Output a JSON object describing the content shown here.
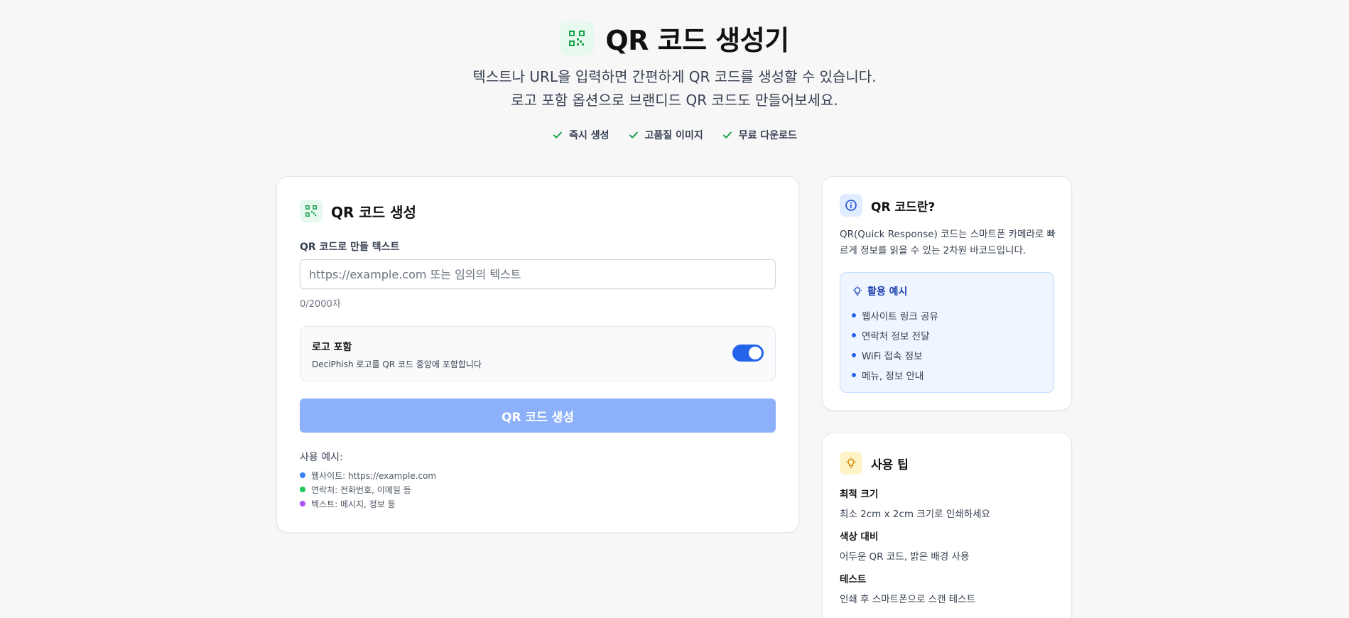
{
  "header": {
    "title": "QR 코드 생성기",
    "subtitle_line1": "텍스트나 URL을 입력하면 간편하게 QR 코드를 생성할 수 있습니다.",
    "subtitle_line2": "로고 포함 옵션으로 브랜디드 QR 코드도 만들어보세요.",
    "features": [
      "즉시 생성",
      "고품질 이미지",
      "무료 다운로드"
    ]
  },
  "generator": {
    "title": "QR 코드 생성",
    "field_label": "QR 코드로 만들 텍스트",
    "input_placeholder": "https://example.com 또는 임의의 텍스트",
    "input_value": "",
    "counter": "0/2000자",
    "logo_option": {
      "title": "로고 포함",
      "description": "DeciPhish 로고를 QR 코드 중앙에 포함합니다",
      "enabled": true
    },
    "button_label": "QR 코드 생성",
    "examples_label": "사용 예시:",
    "examples": [
      {
        "text": "웹사이트: https://example.com",
        "color": "#3b82f6"
      },
      {
        "text": "연락처: 전화번호, 이메일 등",
        "color": "#22c55e"
      },
      {
        "text": "텍스트: 메시지, 정보 등",
        "color": "#a855f7"
      }
    ]
  },
  "about": {
    "title": "QR 코드란?",
    "description": "QR(Quick Response) 코드는 스마트폰 카메라로 빠르게 정보를 읽을 수 있는 2차원 바코드입니다.",
    "usage_title": "활용 예시",
    "usage_items": [
      "웹사이트 링크 공유",
      "연락처 정보 전달",
      "WiFi 접속 정보",
      "메뉴, 정보 안내"
    ]
  },
  "tips": {
    "title": "사용 팁",
    "items": [
      {
        "heading": "최적 크기",
        "text": "최소 2cm x 2cm 크기로 인쇄하세요"
      },
      {
        "heading": "색상 대비",
        "text": "어두운 QR 코드, 밝은 배경 사용"
      },
      {
        "heading": "테스트",
        "text": "인쇄 후 스마트폰으로 스캔 테스트"
      }
    ]
  },
  "colors": {
    "accent_blue": "#2563eb",
    "button_disabled": "#8db0fb",
    "check_green": "#16a34a",
    "logo_green": "#16a34a"
  }
}
